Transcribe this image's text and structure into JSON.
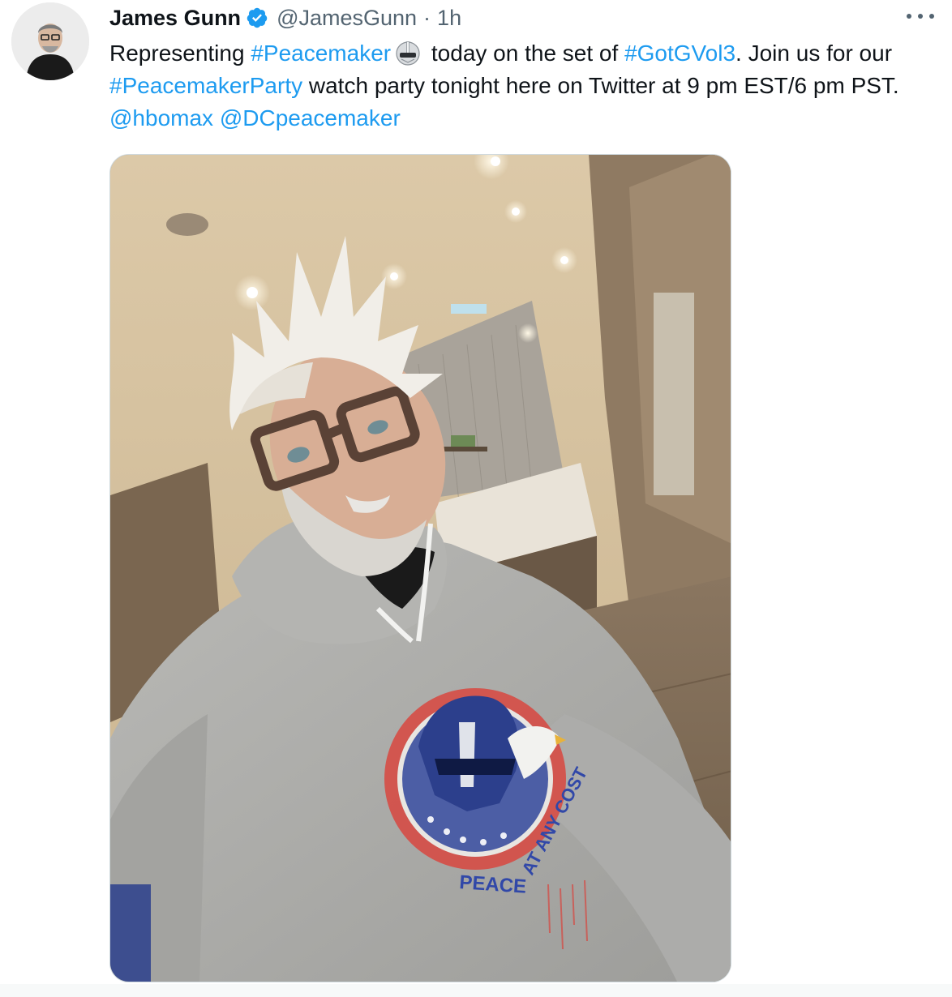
{
  "tweet": {
    "author": {
      "display_name": "James Gunn",
      "handle": "@JamesGunn",
      "verified": true
    },
    "separator": "·",
    "time": "1h",
    "text_parts": [
      {
        "text": "Representing ",
        "type": "plain"
      },
      {
        "text": "#Peacemaker",
        "type": "link"
      },
      {
        "text": "emoji",
        "type": "emoji",
        "icon": "peacemaker-helmet-icon"
      },
      {
        "text": " today on the set of ",
        "type": "plain"
      },
      {
        "text": "#GotGVol3",
        "type": "link"
      },
      {
        "text": ". Join us for our ",
        "type": "plain"
      },
      {
        "text": "#PeacemakerParty",
        "type": "link"
      },
      {
        "text": " watch party tonight here on Twitter at 9 pm EST/6 pm PST. ",
        "type": "plain"
      },
      {
        "text": "@hbomax",
        "type": "link"
      },
      {
        "text": " ",
        "type": "plain"
      },
      {
        "text": "@DCpeacemaker",
        "type": "link"
      }
    ],
    "media": {
      "sweatshirt_text_left": "PEACE",
      "sweatshirt_text_arc": "AT ANY COST"
    }
  },
  "colors": {
    "link": "#1d9bf0",
    "text": "#0f1419",
    "secondary": "#536471",
    "verified": "#1d9bf0"
  }
}
